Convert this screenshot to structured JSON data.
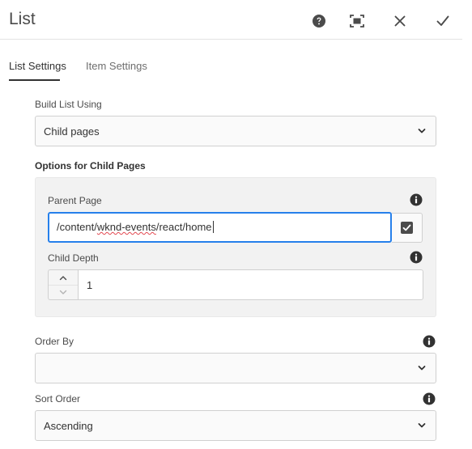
{
  "dialog": {
    "title": "List",
    "actions": {
      "help": "help-icon",
      "fullscreen": "fullscreen-icon",
      "close": "close-icon",
      "done": "checkmark-icon"
    }
  },
  "tabs": [
    {
      "label": "List Settings",
      "active": true
    },
    {
      "label": "Item Settings",
      "active": false
    }
  ],
  "build_list": {
    "label": "Build List Using",
    "value": "Child pages"
  },
  "child_pages_options": {
    "title": "Options for Child Pages",
    "parent_page": {
      "label": "Parent Page",
      "value_prefix": "/content/",
      "value_misspelled": "wknd-events",
      "value_suffix": "/react/home"
    },
    "child_depth": {
      "label": "Child Depth",
      "value": "1"
    }
  },
  "order_by": {
    "label": "Order By",
    "value": ""
  },
  "sort_order": {
    "label": "Sort Order",
    "value": "Ascending"
  },
  "colors": {
    "focus": "#2680eb",
    "text": "#323232",
    "muted": "#6e6e6e"
  }
}
